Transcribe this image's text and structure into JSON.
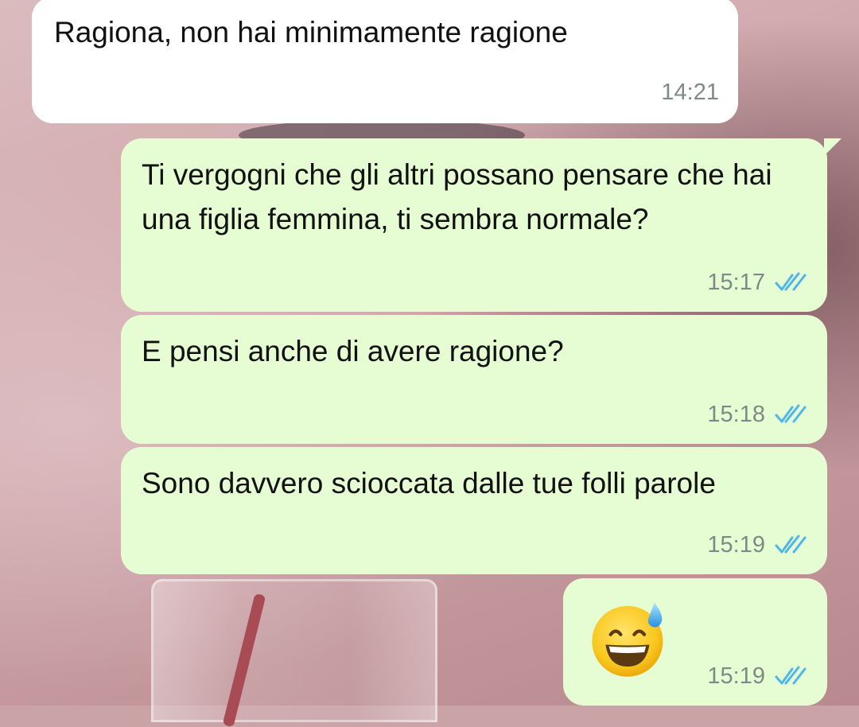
{
  "messages": [
    {
      "id": "m1",
      "direction": "incoming",
      "text": "Ragiona, non hai minimamente ragione",
      "time": "14:21"
    },
    {
      "id": "m2",
      "direction": "outgoing",
      "text": "Ti vergogni che gli altri possano pensare che hai una figlia femmina, ti sembra normale?",
      "time": "15:17",
      "status": "read"
    },
    {
      "id": "m3",
      "direction": "outgoing",
      "text": "E pensi anche di avere ragione?",
      "time": "15:18",
      "status": "read"
    },
    {
      "id": "m4",
      "direction": "outgoing",
      "text": "Sono davvero scioccata dalle tue folli parole",
      "time": "15:19",
      "status": "read"
    },
    {
      "id": "m5",
      "direction": "outgoing",
      "emoji": "grinning-face-with-sweat",
      "time": "15:19",
      "status": "read"
    }
  ],
  "icons": {
    "read_ticks": "double-check-icon",
    "emoji": "grinning-sweat-emoji"
  },
  "colors": {
    "incoming_bubble": "#ffffff",
    "outgoing_bubble": "#e6fdd4",
    "read_ticks": "#4fb6ec",
    "timestamp": "#7d8a85"
  }
}
